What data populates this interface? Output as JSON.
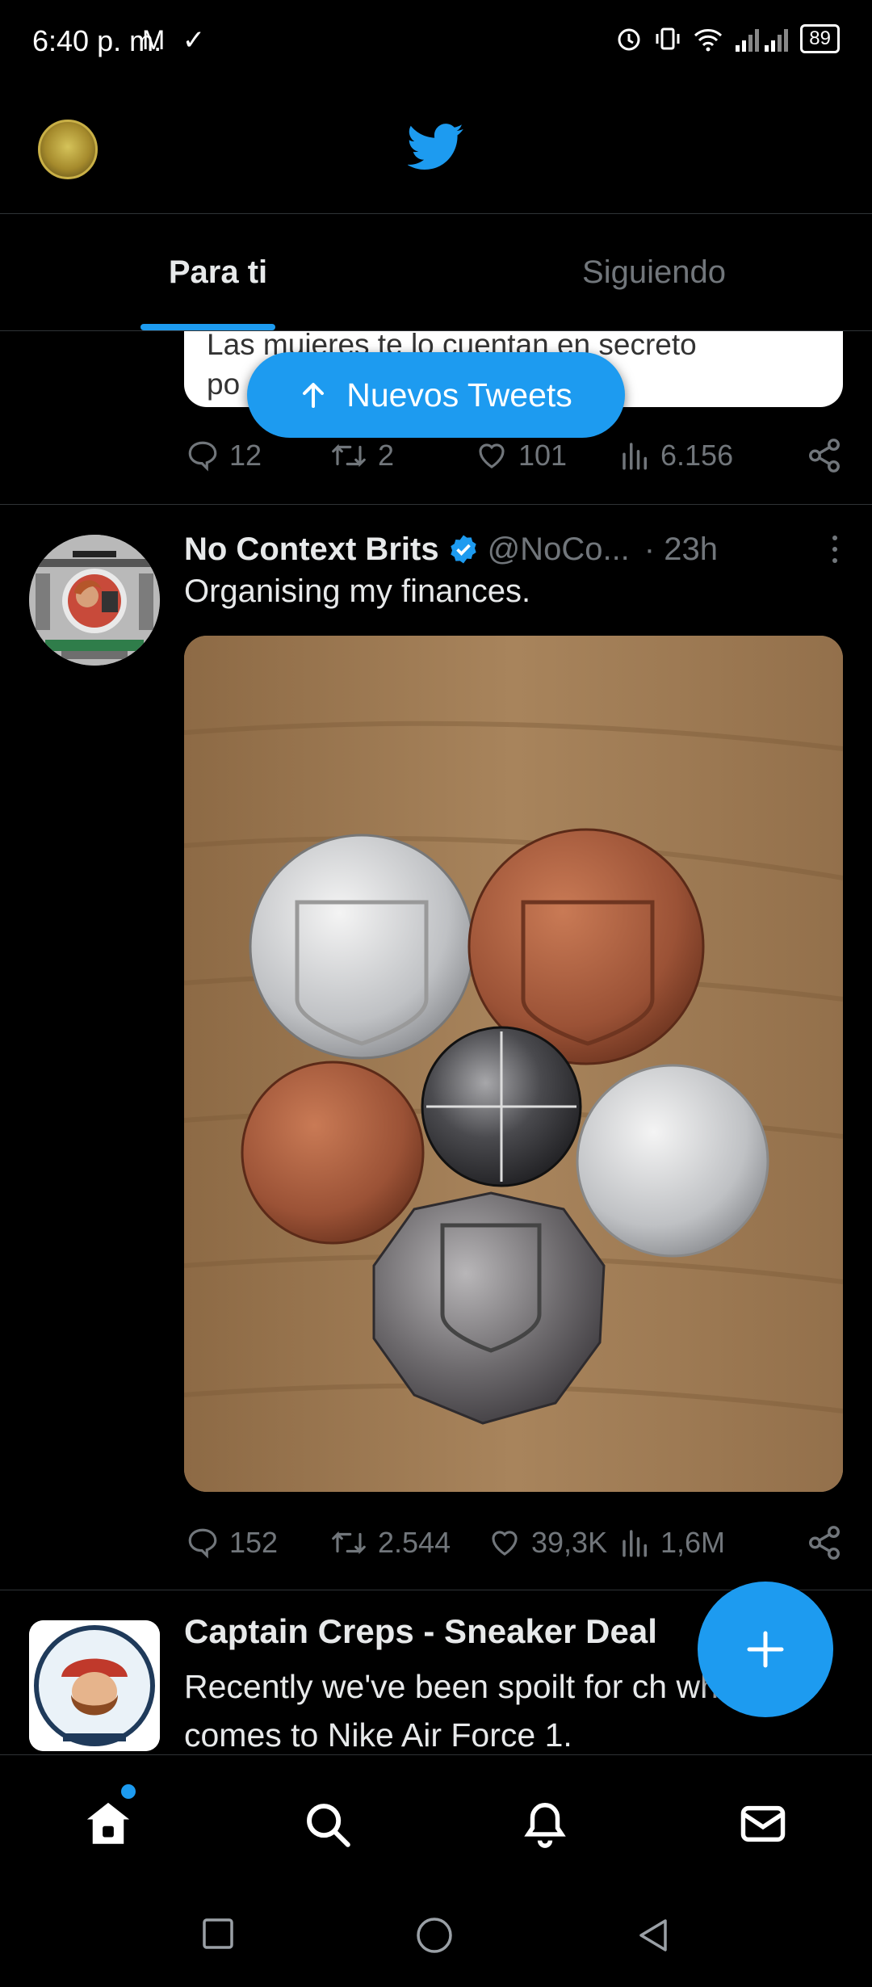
{
  "status_bar": {
    "time": "6:40 p. m.",
    "notif_icons": "M ✓",
    "battery": "89"
  },
  "tabs": [
    {
      "label": "Para ti",
      "active": true
    },
    {
      "label": "Siguiendo",
      "active": false
    }
  ],
  "previous_tweet": {
    "card_text_line1": "Las mujeres te lo cuentan en secreto",
    "card_text_line2": "po",
    "replies": "12",
    "retweets": "2",
    "likes": "101",
    "views": "6.156"
  },
  "new_tweets_pill": {
    "label": "Nuevos Tweets"
  },
  "tweet": {
    "author": "No Context Brits",
    "handle": "@NoCo...",
    "time": "· 23h",
    "text": "Organising my finances.",
    "replies": "152",
    "retweets": "2.544",
    "likes": "39,3K",
    "views": "1,6M"
  },
  "next_tweet": {
    "author": "Captain Creps - Sneaker Deal",
    "text": "Recently we've been spoilt for ch when it comes to Nike Air Force 1."
  },
  "colors": {
    "accent": "#1d9bf0",
    "background": "#000000",
    "muted": "#71767b",
    "divider": "#2f3336"
  },
  "icons": [
    "twitter-bird-icon",
    "reply-icon",
    "retweet-icon",
    "like-icon",
    "views-icon",
    "share-icon",
    "verified-icon",
    "more-icon",
    "home-icon",
    "search-icon",
    "notifications-icon",
    "messages-icon",
    "compose-icon"
  ]
}
